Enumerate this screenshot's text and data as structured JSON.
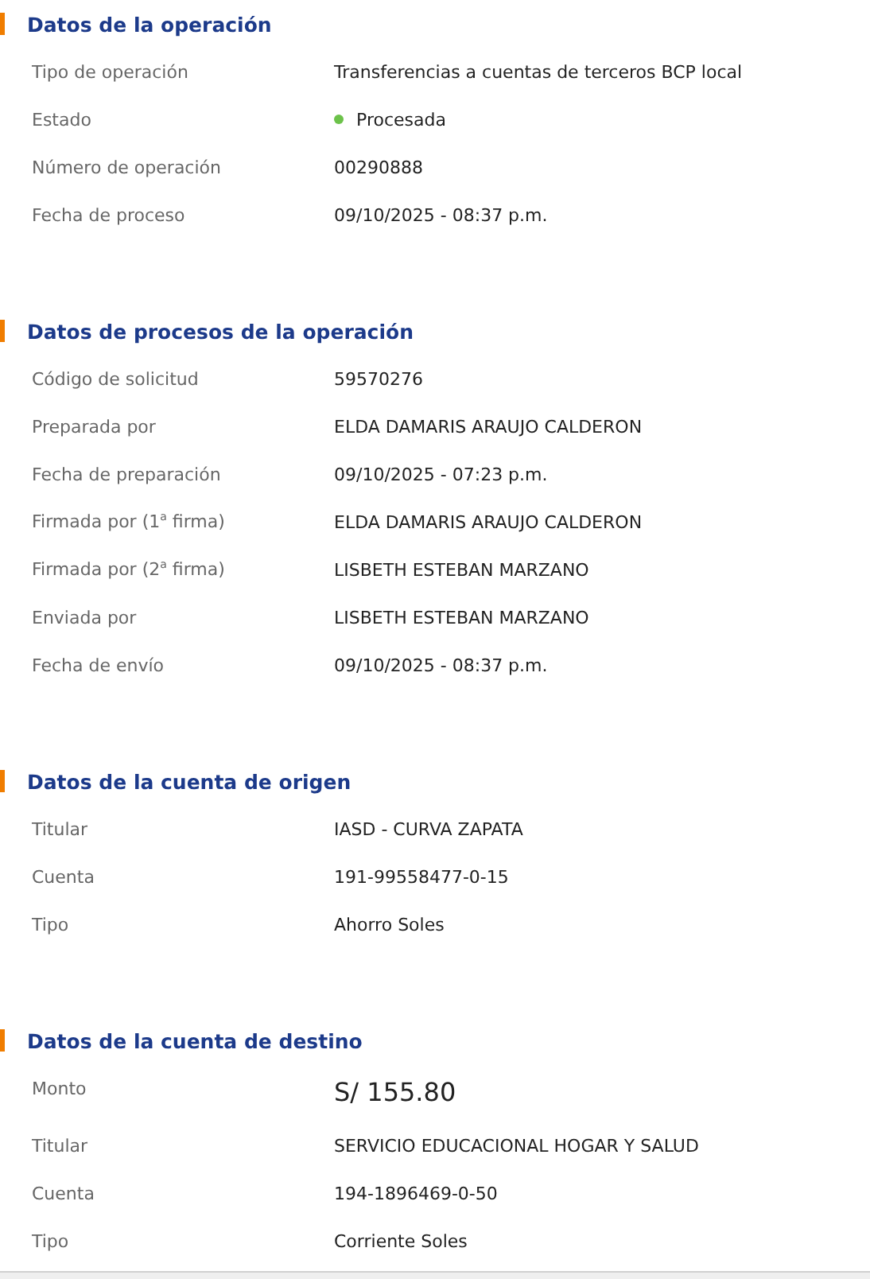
{
  "sections": [
    {
      "title": "Datos de la operación",
      "rows": [
        {
          "kind": "text",
          "label": "Tipo de operación",
          "value": "Transferencias a cuentas de terceros BCP local"
        },
        {
          "kind": "status",
          "label": "Estado",
          "value": "Procesada",
          "color": "#6cc24a"
        },
        {
          "kind": "text",
          "label": "Número de operación",
          "value": "00290888"
        },
        {
          "kind": "text",
          "label": "Fecha de proceso",
          "value": "09/10/2025 - 08:37 p.m."
        }
      ]
    },
    {
      "title": "Datos de procesos de la operación",
      "rows": [
        {
          "kind": "text",
          "label": "Código de solicitud",
          "value": "59570276"
        },
        {
          "kind": "text",
          "label": "Preparada por",
          "value": "ELDA DAMARIS ARAUJO CALDERON"
        },
        {
          "kind": "text",
          "label": "Fecha de preparación",
          "value": "09/10/2025 - 07:23 p.m."
        },
        {
          "kind": "text",
          "label": "Firmada por (1$^{a}$ firma)",
          "value": "ELDA DAMARIS ARAUJO CALDERON"
        },
        {
          "kind": "text",
          "label": "Firmada por (2$^{a}$ firma)",
          "value": "LISBETH ESTEBAN MARZANO"
        },
        {
          "kind": "text",
          "label": "Enviada por",
          "value": "LISBETH ESTEBAN MARZANO"
        },
        {
          "kind": "text",
          "label": "Fecha de envío",
          "value": "09/10/2025 - 08:37 p.m."
        }
      ]
    },
    {
      "title": "Datos de la cuenta de origen",
      "rows": [
        {
          "kind": "text",
          "label": "Titular",
          "value": "IASD - CURVA ZAPATA"
        },
        {
          "kind": "text",
          "label": "Cuenta",
          "value": "191-99558477-0-15"
        },
        {
          "kind": "text",
          "label": "Tipo",
          "value": "Ahorro Soles"
        }
      ]
    },
    {
      "title": "Datos de la cuenta de destino",
      "rows": [
        {
          "kind": "amount",
          "label": "Monto",
          "value": "S/ 155.80"
        },
        {
          "kind": "text",
          "label": "Titular",
          "value": "SERVICIO EDUCACIONAL HOGAR Y SALUD"
        },
        {
          "kind": "text",
          "label": "Cuenta",
          "value": "194-1896469-0-50"
        },
        {
          "kind": "text",
          "label": "Tipo",
          "value": "Corriente Soles"
        }
      ]
    }
  ]
}
